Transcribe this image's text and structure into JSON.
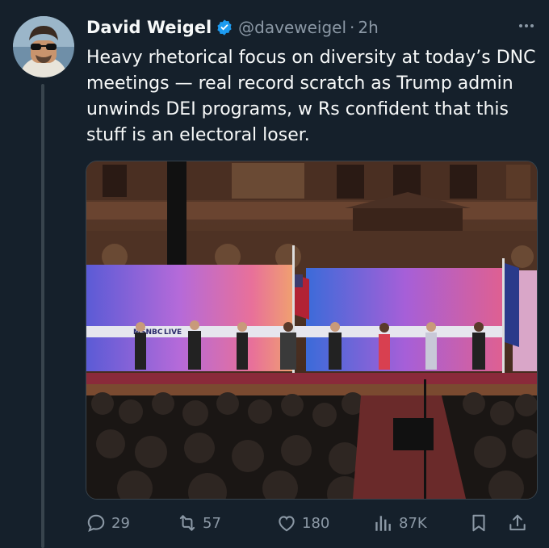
{
  "author": {
    "name": "David Weigel",
    "handle": "@daveweigel",
    "time": "2h",
    "separator": "·"
  },
  "tweet": {
    "text": "Heavy rhetorical focus on diversity at today’s DNC meetings — real record scratch as Trump admin unwinds DEI programs, w Rs confident that this stuff is an electoral loser."
  },
  "media": {
    "stage_banner": "MSNBC",
    "stage_tag": "LIVE"
  },
  "actions": {
    "replies": "29",
    "reposts": "57",
    "likes": "180",
    "views": "87K"
  },
  "colors": {
    "background": "#15202b",
    "text": "#f7f9f9",
    "muted": "#8b98a5",
    "verified": "#1d9bf0"
  },
  "icons": [
    "reply-icon",
    "repost-icon",
    "like-icon",
    "views-icon",
    "bookmark-icon",
    "share-icon",
    "verified-badge-icon",
    "more-icon"
  ]
}
